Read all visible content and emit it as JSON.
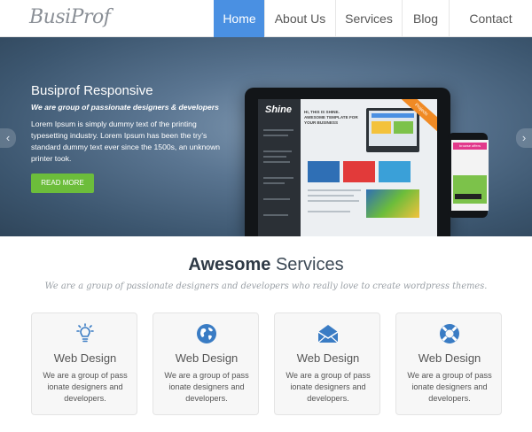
{
  "header": {
    "logo": "BusiProf",
    "nav": [
      {
        "label": "Home",
        "active": true
      },
      {
        "label": "About Us",
        "active": false
      },
      {
        "label": "Services",
        "active": false
      },
      {
        "label": "Blog",
        "active": false
      },
      {
        "label": "Contact",
        "active": false
      }
    ]
  },
  "hero": {
    "title": "Busiprof Responsive",
    "tagline": "We are group of passionate designers & developers",
    "text": "Lorem Ipsum is simply dummy text of the printing typesetting industry. Lorem Ipsum has been the try's standard dummy text ever since the 1500s, an unknown printer took.",
    "button_label": "READ MORE",
    "prev_icon": "chevron-left-icon",
    "next_icon": "chevron-right-icon",
    "mockup": {
      "tablet_logo": "Shine",
      "tablet_headline": "HI, THIS IS SHINE. AWESOME TEMPLATE FOR YOUR BUSINESS",
      "ribbon": "Projects",
      "phone_tag": "browse offers"
    }
  },
  "services": {
    "title_strong": "Awesome",
    "title_light": "Services",
    "subtitle": "We are a group of passionate designers and developers who really love to create  wordpress themes.",
    "cards": [
      {
        "icon": "lightbulb-icon",
        "title": "Web Design",
        "text": "We are a group of pass ionate designers and developers."
      },
      {
        "icon": "globe-icon",
        "title": "Web Design",
        "text": "We are a group of pass ionate designers and developers."
      },
      {
        "icon": "envelope-icon",
        "title": "Web Design",
        "text": "We are a group of pass ionate designers and developers."
      },
      {
        "icon": "lifebuoy-icon",
        "title": "Web Design",
        "text": "We are a group of pass ionate designers and developers."
      }
    ]
  },
  "colors": {
    "accent": "#4a90e2",
    "button": "#6cbd3b",
    "icon": "#3a7cc4"
  }
}
